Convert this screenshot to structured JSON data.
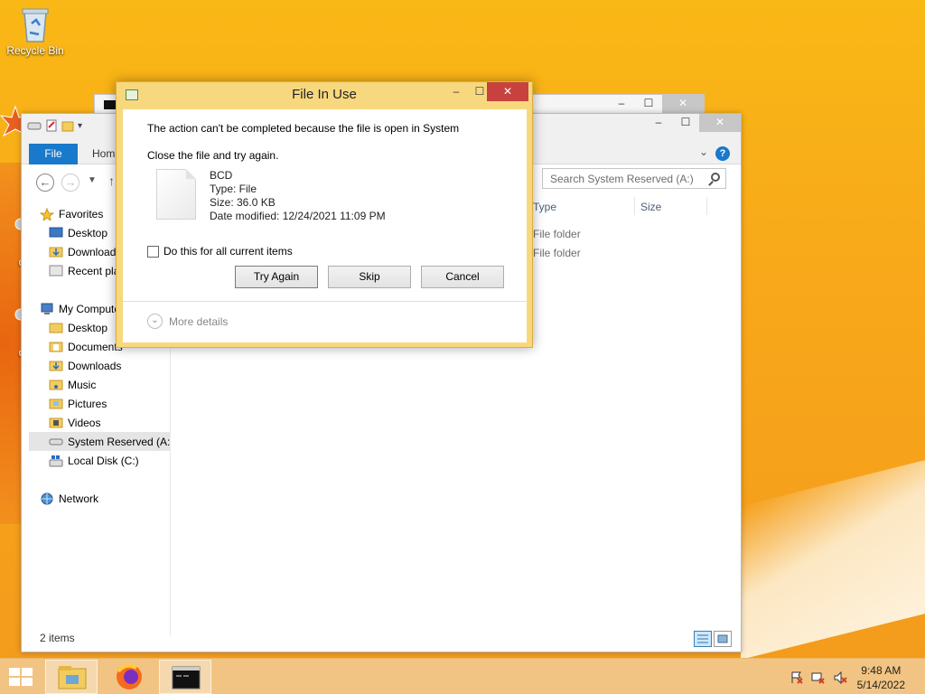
{
  "desktop": {
    "icons": [
      {
        "label": "Recycle Bin"
      },
      {
        "label": "Dat"
      },
      {
        "label": "de"
      },
      {
        "label": "de"
      }
    ]
  },
  "explorer": {
    "ribbon_tabs": [
      "File",
      "Home"
    ],
    "search_placeholder": "Search System Reserved (A:)",
    "nav": {
      "favorites": "Favorites",
      "fav_items": [
        "Desktop",
        "Downloads",
        "Recent places"
      ],
      "computer": "My Computer",
      "computer_items": [
        "Desktop",
        "Documents",
        "Downloads",
        "Music",
        "Pictures",
        "Videos",
        "System Reserved (A:)",
        "Local Disk (C:)"
      ],
      "network": "Network"
    },
    "columns": {
      "type": "Type",
      "size": "Size"
    },
    "rows": [
      {
        "type": "File folder"
      },
      {
        "type": "File folder"
      }
    ],
    "status": "2 items"
  },
  "dialog": {
    "title": "File In Use",
    "message": "The action can't be completed because the file is open in System",
    "instruction": "Close the file and try again.",
    "file": {
      "name": "BCD",
      "type": "Type: File",
      "size": "Size: 36.0 KB",
      "modified": "Date modified: 12/24/2021 11:09 PM"
    },
    "checkbox_label": "Do this for all current items",
    "checkbox_checked": false,
    "buttons": {
      "try_again": "Try Again",
      "skip": "Skip",
      "cancel": "Cancel"
    },
    "more_details": "More details"
  },
  "taskbar": {
    "apps": [
      "file-explorer-icon",
      "firefox-icon",
      "command-prompt-icon"
    ],
    "time": "9:48 AM",
    "date": "5/14/2022"
  },
  "colors": {
    "accent": "#1979ca",
    "close_red": "#c7423e",
    "dialog_frame": "#f8d87e"
  }
}
